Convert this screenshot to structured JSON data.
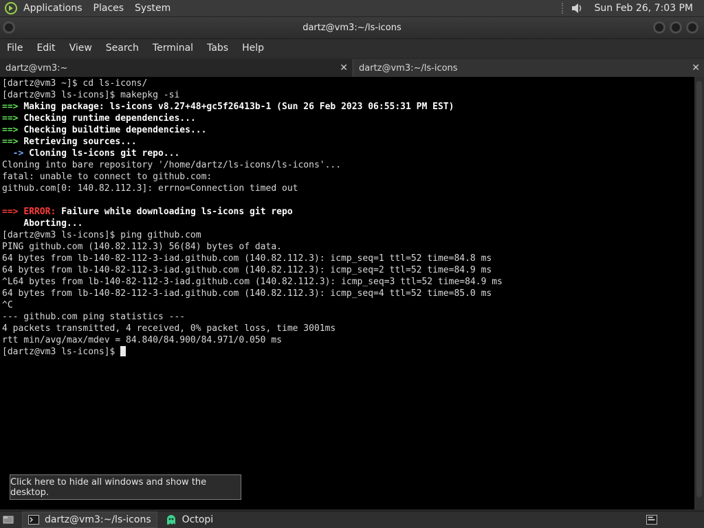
{
  "top_panel": {
    "menus": [
      "Applications",
      "Places",
      "System"
    ],
    "clock": "Sun Feb 26,  7:03 PM"
  },
  "window": {
    "title": "dartz@vm3:~/ls-icons"
  },
  "menubar": [
    "File",
    "Edit",
    "View",
    "Search",
    "Terminal",
    "Tabs",
    "Help"
  ],
  "tabs": [
    {
      "label": "dartz@vm3:~",
      "close": "✕"
    },
    {
      "label": "dartz@vm3:~/ls-icons",
      "close": "✕"
    }
  ],
  "terminal": {
    "lines": [
      "[dartz@vm3 ~]$ cd ls-icons/",
      "[dartz@vm3 ls-icons]$ makepkg -si",
      "==> Making package: ls-icons v8.27+48+gc5f26413b-1 (Sun 26 Feb 2023 06:55:31 PM EST)",
      "==> Checking runtime dependencies...",
      "==> Checking buildtime dependencies...",
      "==> Retrieving sources...",
      "  -> Cloning ls-icons git repo...",
      "Cloning into bare repository '/home/dartz/ls-icons/ls-icons'...",
      "fatal: unable to connect to github.com:",
      "github.com[0: 140.82.112.3]: errno=Connection timed out",
      "",
      "==> ERROR: Failure while downloading ls-icons git repo",
      "    Aborting...",
      "[dartz@vm3 ls-icons]$ ping github.com",
      "PING github.com (140.82.112.3) 56(84) bytes of data.",
      "64 bytes from lb-140-82-112-3-iad.github.com (140.82.112.3): icmp_seq=1 ttl=52 time=84.8 ms",
      "64 bytes from lb-140-82-112-3-iad.github.com (140.82.112.3): icmp_seq=2 ttl=52 time=84.9 ms",
      "^L64 bytes from lb-140-82-112-3-iad.github.com (140.82.112.3): icmp_seq=3 ttl=52 time=84.9 ms",
      "64 bytes from lb-140-82-112-3-iad.github.com (140.82.112.3): icmp_seq=4 ttl=52 time=85.0 ms",
      "^C",
      "--- github.com ping statistics ---",
      "4 packets transmitted, 4 received, 0% packet loss, time 3001ms",
      "rtt min/avg/max/mdev = 84.840/84.900/84.971/0.050 ms",
      "[dartz@vm3 ls-icons]$ "
    ]
  },
  "tooltip": "Click here to hide all windows and show the desktop.",
  "taskbar": [
    {
      "label": "dartz@vm3:~/ls-icons"
    },
    {
      "label": "Octopi"
    }
  ],
  "icons": {
    "app_menu": "gnome-foot-icon",
    "volume": "volume-icon",
    "show_desktop": "show-desktop-icon",
    "terminal_task": "terminal-icon",
    "octopi_task": "octopi-ghost-icon",
    "tray": "tray-window-icon"
  },
  "colors": {
    "terminal_bg": "#000000",
    "prompt_green": "#66e35a",
    "error_red": "#ff3b3b",
    "arrow_blue": "#79a7ff"
  }
}
